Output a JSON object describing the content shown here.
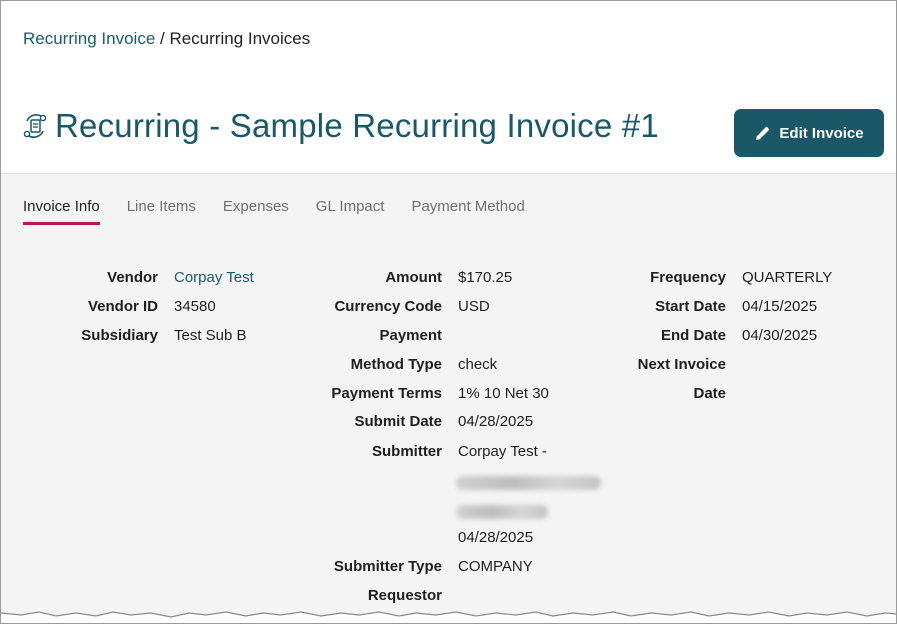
{
  "breadcrumb": {
    "parent": "Recurring Invoice",
    "separator": " / ",
    "current": "Recurring Invoices"
  },
  "page": {
    "title": "Recurring - Sample Recurring Invoice #1",
    "icon": "recurring-invoice-icon"
  },
  "toolbar": {
    "edit_label": "Edit Invoice",
    "edit_icon": "pencil-icon"
  },
  "tabs": [
    {
      "label": "Invoice Info",
      "active": true
    },
    {
      "label": "Line Items",
      "active": false
    },
    {
      "label": "Expenses",
      "active": false
    },
    {
      "label": "GL Impact",
      "active": false
    },
    {
      "label": "Payment Method",
      "active": false
    }
  ],
  "col1": {
    "vendor_label": "Vendor",
    "vendor_value": "Corpay Test",
    "vendor_id_label": "Vendor ID",
    "vendor_id_value": "34580",
    "subsidiary_label": "Subsidiary",
    "subsidiary_value": "Test Sub B"
  },
  "col2": {
    "amount_label": "Amount",
    "amount_value": "$170.25",
    "currency_label": "Currency Code",
    "currency_value": "USD",
    "payment_label_line1": "Payment",
    "payment_label_line2": "Method Type",
    "payment_value": "check",
    "terms_label": "Payment Terms",
    "terms_value": "1% 10 Net 30",
    "submit_date_label": "Submit Date",
    "submit_date_value": "04/28/2025",
    "submitter_label": "Submitter",
    "submitter_value": "Corpay Test -",
    "submitter_date": "04/28/2025",
    "submitter_type_label": "Submitter Type",
    "submitter_type_value": "COMPANY",
    "requestor_label": "Requestor"
  },
  "col3": {
    "frequency_label": "Frequency",
    "frequency_value": "QUARTERLY",
    "start_date_label": "Start Date",
    "start_date_value": "04/15/2025",
    "end_date_label": "End Date",
    "end_date_value": "04/30/2025",
    "next_invoice_label_line1": "Next Invoice",
    "next_invoice_label_line2": "Date"
  },
  "colors": {
    "accent": "#17596a",
    "button": "#1a5868",
    "tab_underline": "#b81a49",
    "content_bg": "#f4f4f4"
  }
}
